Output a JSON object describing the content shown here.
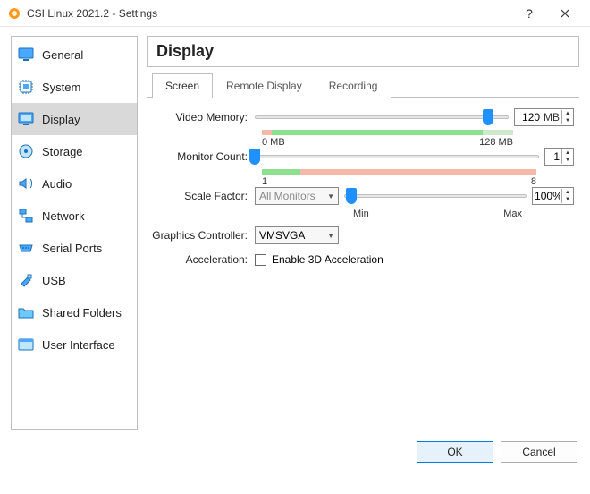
{
  "window": {
    "title": "CSI Linux 2021.2 - Settings"
  },
  "sidebar": {
    "items": [
      {
        "label": "General"
      },
      {
        "label": "System"
      },
      {
        "label": "Display"
      },
      {
        "label": "Storage"
      },
      {
        "label": "Audio"
      },
      {
        "label": "Network"
      },
      {
        "label": "Serial Ports"
      },
      {
        "label": "USB"
      },
      {
        "label": "Shared Folders"
      },
      {
        "label": "User Interface"
      }
    ]
  },
  "main": {
    "heading": "Display",
    "tabs": [
      {
        "label": "Screen"
      },
      {
        "label": "Remote Display"
      },
      {
        "label": "Recording"
      }
    ],
    "labels": {
      "video_memory": "Video Memory:",
      "monitor_count": "Monitor Count:",
      "scale_factor": "Scale Factor:",
      "graphics_controller": "Graphics Controller:",
      "acceleration": "Acceleration:",
      "enable_3d": "Enable 3D Acceleration",
      "all_monitors": "All Monitors"
    },
    "values": {
      "video_memory": "120",
      "video_memory_unit": "MB",
      "video_memory_min": "0 MB",
      "video_memory_max": "128 MB",
      "monitor_count": "1",
      "monitor_min": "1",
      "monitor_max": "8",
      "scale_factor": "100%",
      "scale_min": "Min",
      "scale_max": "Max",
      "graphics_controller": "VMSVGA"
    }
  },
  "footer": {
    "ok": "OK",
    "cancel": "Cancel"
  }
}
